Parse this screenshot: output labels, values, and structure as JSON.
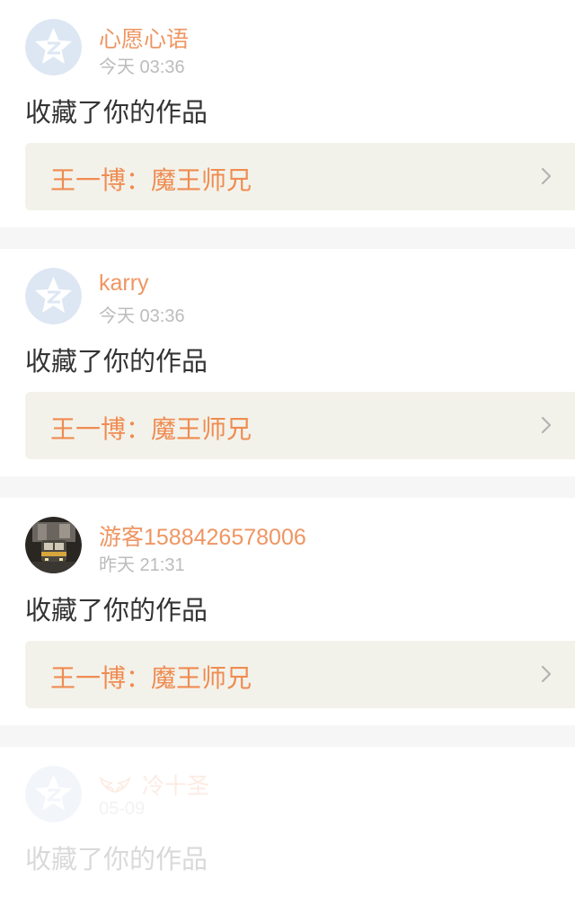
{
  "notifications": [
    {
      "nickname": "心愿心语",
      "time": "今天 03:36",
      "action": "收藏了你的作品",
      "work_title": "王一博：魔王师兄",
      "avatar": "default-q-avatar"
    },
    {
      "nickname": "karry",
      "time": "今天 03:36",
      "action": "收藏了你的作品",
      "work_title": "王一博：魔王师兄",
      "avatar": "default-q-avatar"
    },
    {
      "nickname": "游客1588426578006",
      "time": "昨天 21:31",
      "action": "收藏了你的作品",
      "work_title": "王一博：魔王师兄",
      "avatar": "train-photo-avatar"
    },
    {
      "nickname": "冷十圣",
      "time": "05-09",
      "action": "收藏了你的作品",
      "avatar": "default-q-avatar",
      "badge_icon": "wings-badge-icon"
    }
  ],
  "colors": {
    "accent_pink": "#ea5c88",
    "nickname_orange": "#ef9562",
    "work_title_orange": "#ef8c52",
    "work_bg": "#f3f2ea",
    "time_gray": "#bcbcbc",
    "page_bg": "#f6f6f6"
  }
}
